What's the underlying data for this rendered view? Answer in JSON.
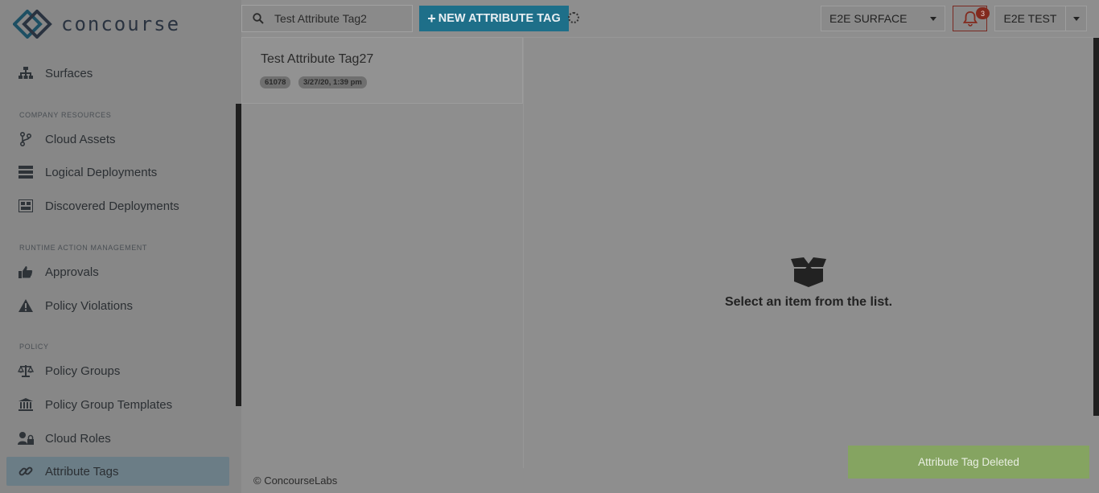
{
  "brand": {
    "name": "concourse"
  },
  "sidebar": {
    "top_item": {
      "label": "Surfaces",
      "icon": "sitemap-icon"
    },
    "sections": [
      {
        "header": "COMPANY RESOURCES",
        "items": [
          {
            "label": "Cloud Assets",
            "icon": "branch-icon"
          },
          {
            "label": "Logical Deployments",
            "icon": "server-icon"
          },
          {
            "label": "Discovered Deployments",
            "icon": "discover-icon"
          }
        ]
      },
      {
        "header": "RUNTIME ACTION MANAGEMENT",
        "items": [
          {
            "label": "Approvals",
            "icon": "thumbs-up-icon"
          },
          {
            "label": "Policy Violations",
            "icon": "warning-icon"
          }
        ]
      },
      {
        "header": "POLICY",
        "items": [
          {
            "label": "Policy Groups",
            "icon": "balance-scale-icon"
          },
          {
            "label": "Policy Group Templates",
            "icon": "institution-icon"
          },
          {
            "label": "Cloud Roles",
            "icon": "user-lock-icon"
          },
          {
            "label": "Attribute Tags",
            "icon": "link-icon",
            "active": true
          }
        ]
      }
    ]
  },
  "topbar": {
    "search_value": "Test Attribute Tag2",
    "new_button": "NEW ATTRIBUTE TAG",
    "surface": "E2E SURFACE",
    "notification_count": "3",
    "user": "E2E TEST"
  },
  "list": {
    "items": [
      {
        "title": "Test Attribute Tag27",
        "id": "61078",
        "date": "3/27/20, 1:39 pm"
      }
    ]
  },
  "detail": {
    "empty_message": "Select an item from the list."
  },
  "footer": {
    "copyright": "© ConcourseLabs"
  },
  "toast": {
    "message": "Attribute Tag Deleted"
  },
  "colors": {
    "primary": "#1e6f89",
    "danger": "#822a1e",
    "success": "#85a461",
    "overlay": "#8e8e8e"
  }
}
